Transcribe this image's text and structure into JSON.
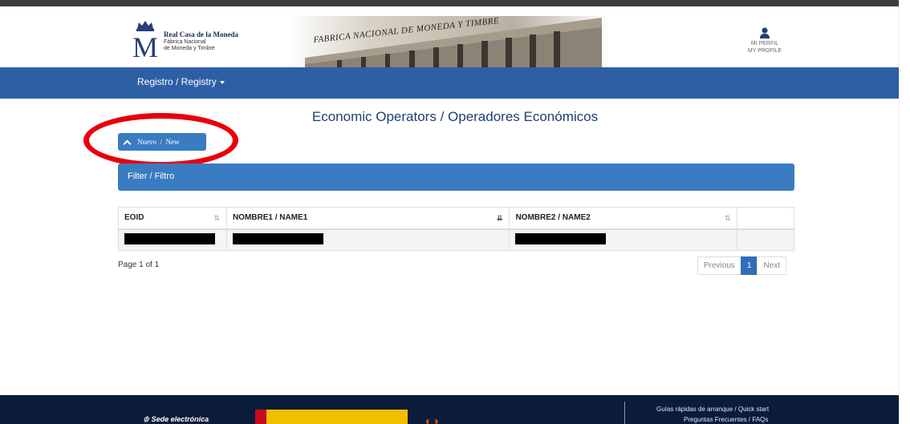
{
  "header": {
    "logo_line1": "Real Casa de la Moneda",
    "logo_line2": "Fábrica Nacional",
    "logo_line3": "de Moneda y Timbre",
    "banner_text": "FABRICA NACIONAL DE MONEDA Y TIMBRE",
    "profile_line1": "MI PERFIL",
    "profile_line2": "MY PROFILE"
  },
  "nav": {
    "registry_menu": "Registro / Registry"
  },
  "main": {
    "title": "Economic Operators / Operadores Económicos",
    "new_button": "Nuevo  /  New",
    "filter_label": "Filter / Filtro",
    "columns": [
      "EOID",
      "NOMBRE1 / NAME1",
      "NOMBRE2 / NAME2",
      ""
    ],
    "page_info": "Page 1 of 1",
    "pagination": {
      "previous": "Previous",
      "current": "1",
      "next": "Next"
    }
  },
  "footer": {
    "sede": "Sede electrónica",
    "link1": "Guías rápidas de arranque / Quick start",
    "link2": "Preguntas Frecuentes / FAQs"
  },
  "colors": {
    "nav_blue": "#2e5fa5",
    "button_blue": "#3a7cc2",
    "annotation_red": "#e8000b",
    "footer_navy": "#0b1c3a"
  }
}
